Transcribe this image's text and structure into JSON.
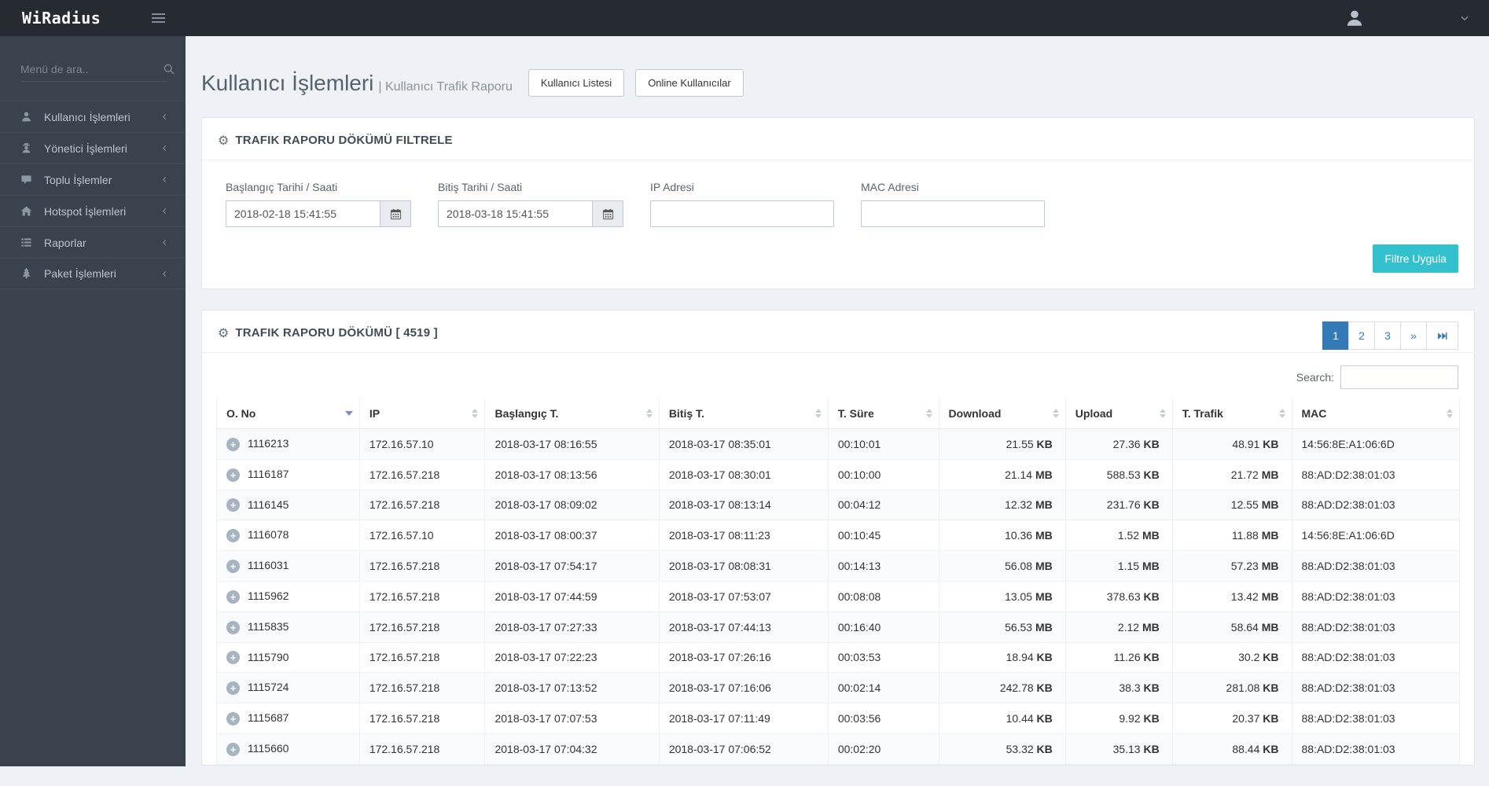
{
  "navbar": {
    "brand": "WiRadius"
  },
  "sidebar": {
    "search_placeholder": "Menü de ara..",
    "items": [
      {
        "label": "Kullanıcı İşlemleri",
        "icon": "user-icon"
      },
      {
        "label": "Yönetici İşlemleri",
        "icon": "user-secret-icon"
      },
      {
        "label": "Toplu İşlemler",
        "icon": "comment-icon"
      },
      {
        "label": "Hotspot İşlemleri",
        "icon": "home-icon"
      },
      {
        "label": "Raporlar",
        "icon": "list-icon"
      },
      {
        "label": "Paket İşlemleri",
        "icon": "tree-icon"
      }
    ]
  },
  "page": {
    "title": "Kullanıcı İşlemleri",
    "subtitle": "| Kullanıcı Trafik Raporu",
    "actions": [
      {
        "label": "Kullanıcı Listesi"
      },
      {
        "label": "Online Kullanıcılar"
      }
    ]
  },
  "filter_panel": {
    "title": "TRAFIK RAPORU DÖKÜMÜ FILTRELE",
    "fields": [
      {
        "label": "Başlangıç Tarihi / Saati",
        "value": "2018-02-18 15:41:55",
        "type": "datetime"
      },
      {
        "label": "Bitiş Tarihi / Saati",
        "value": "2018-03-18 15:41:55",
        "type": "datetime"
      },
      {
        "label": "IP Adresi",
        "value": "",
        "type": "text"
      },
      {
        "label": "MAC Adresi",
        "value": "",
        "type": "text"
      }
    ],
    "apply_label": "Filtre Uygula"
  },
  "report_panel": {
    "title": "TRAFIK RAPORU DÖKÜMÜ [ 4519 ]",
    "pagination": {
      "pages": [
        "1",
        "2",
        "3",
        "»"
      ],
      "active": "1",
      "last_icon": "last-page-icon"
    },
    "search_label": "Search:",
    "table": {
      "columns": [
        "O. No",
        "IP",
        "Başlangıç T.",
        "Bitiş T.",
        "T. Süre",
        "Download",
        "Upload",
        "T. Trafik",
        "MAC"
      ],
      "sorted_column": "O. No",
      "sort_direction": "desc",
      "rows": [
        {
          "o_no": "1116213",
          "ip": "172.16.57.10",
          "start": "2018-03-17 08:16:55",
          "end": "2018-03-17 08:35:01",
          "duration": "00:10:01",
          "download": "21.55",
          "download_unit": "KB",
          "upload": "27.36",
          "upload_unit": "KB",
          "traffic": "48.91",
          "traffic_unit": "KB",
          "mac": "14:56:8E:A1:06:6D"
        },
        {
          "o_no": "1116187",
          "ip": "172.16.57.218",
          "start": "2018-03-17 08:13:56",
          "end": "2018-03-17 08:30:01",
          "duration": "00:10:00",
          "download": "21.14",
          "download_unit": "MB",
          "upload": "588.53",
          "upload_unit": "KB",
          "traffic": "21.72",
          "traffic_unit": "MB",
          "mac": "88:AD:D2:38:01:03"
        },
        {
          "o_no": "1116145",
          "ip": "172.16.57.218",
          "start": "2018-03-17 08:09:02",
          "end": "2018-03-17 08:13:14",
          "duration": "00:04:12",
          "download": "12.32",
          "download_unit": "MB",
          "upload": "231.76",
          "upload_unit": "KB",
          "traffic": "12.55",
          "traffic_unit": "MB",
          "mac": "88:AD:D2:38:01:03"
        },
        {
          "o_no": "1116078",
          "ip": "172.16.57.10",
          "start": "2018-03-17 08:00:37",
          "end": "2018-03-17 08:11:23",
          "duration": "00:10:45",
          "download": "10.36",
          "download_unit": "MB",
          "upload": "1.52",
          "upload_unit": "MB",
          "traffic": "11.88",
          "traffic_unit": "MB",
          "mac": "14:56:8E:A1:06:6D"
        },
        {
          "o_no": "1116031",
          "ip": "172.16.57.218",
          "start": "2018-03-17 07:54:17",
          "end": "2018-03-17 08:08:31",
          "duration": "00:14:13",
          "download": "56.08",
          "download_unit": "MB",
          "upload": "1.15",
          "upload_unit": "MB",
          "traffic": "57.23",
          "traffic_unit": "MB",
          "mac": "88:AD:D2:38:01:03"
        },
        {
          "o_no": "1115962",
          "ip": "172.16.57.218",
          "start": "2018-03-17 07:44:59",
          "end": "2018-03-17 07:53:07",
          "duration": "00:08:08",
          "download": "13.05",
          "download_unit": "MB",
          "upload": "378.63",
          "upload_unit": "KB",
          "traffic": "13.42",
          "traffic_unit": "MB",
          "mac": "88:AD:D2:38:01:03"
        },
        {
          "o_no": "1115835",
          "ip": "172.16.57.218",
          "start": "2018-03-17 07:27:33",
          "end": "2018-03-17 07:44:13",
          "duration": "00:16:40",
          "download": "56.53",
          "download_unit": "MB",
          "upload": "2.12",
          "upload_unit": "MB",
          "traffic": "58.64",
          "traffic_unit": "MB",
          "mac": "88:AD:D2:38:01:03"
        },
        {
          "o_no": "1115790",
          "ip": "172.16.57.218",
          "start": "2018-03-17 07:22:23",
          "end": "2018-03-17 07:26:16",
          "duration": "00:03:53",
          "download": "18.94",
          "download_unit": "KB",
          "upload": "11.26",
          "upload_unit": "KB",
          "traffic": "30.2",
          "traffic_unit": "KB",
          "mac": "88:AD:D2:38:01:03"
        },
        {
          "o_no": "1115724",
          "ip": "172.16.57.218",
          "start": "2018-03-17 07:13:52",
          "end": "2018-03-17 07:16:06",
          "duration": "00:02:14",
          "download": "242.78",
          "download_unit": "KB",
          "upload": "38.3",
          "upload_unit": "KB",
          "traffic": "281.08",
          "traffic_unit": "KB",
          "mac": "88:AD:D2:38:01:03"
        },
        {
          "o_no": "1115687",
          "ip": "172.16.57.218",
          "start": "2018-03-17 07:07:53",
          "end": "2018-03-17 07:11:49",
          "duration": "00:03:56",
          "download": "10.44",
          "download_unit": "KB",
          "upload": "9.92",
          "upload_unit": "KB",
          "traffic": "20.37",
          "traffic_unit": "KB",
          "mac": "88:AD:D2:38:01:03"
        },
        {
          "o_no": "1115660",
          "ip": "172.16.57.218",
          "start": "2018-03-17 07:04:32",
          "end": "2018-03-17 07:06:52",
          "duration": "00:02:20",
          "download": "53.32",
          "download_unit": "KB",
          "upload": "35.13",
          "upload_unit": "KB",
          "traffic": "88.44",
          "traffic_unit": "KB",
          "mac": "88:AD:D2:38:01:03"
        }
      ]
    }
  },
  "colors": {
    "navbar_bg": "#262b31",
    "sidebar_bg": "#3a434d",
    "accent_teal": "#34c1ce",
    "pagination_blue": "#337ab7",
    "content_bg": "#eef1f5"
  }
}
